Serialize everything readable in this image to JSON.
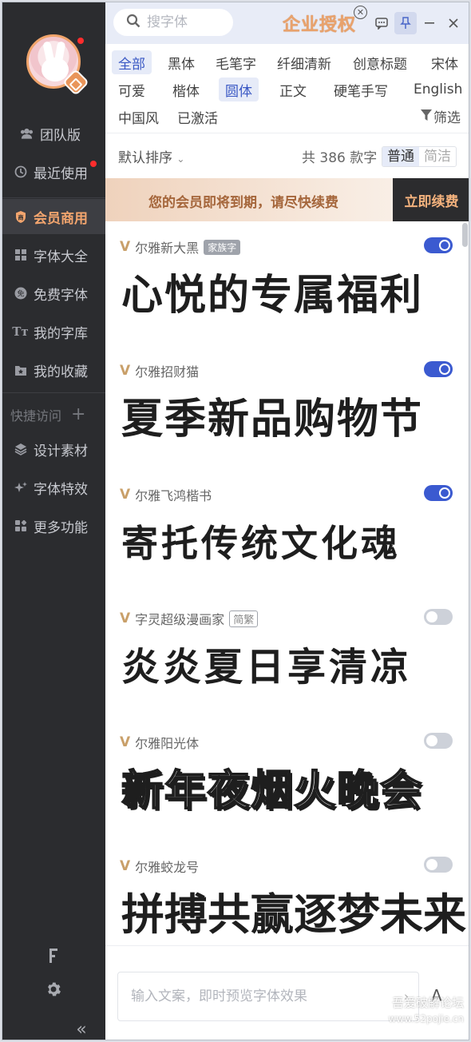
{
  "sidebar": {
    "items": [
      {
        "label": "团队版",
        "icon": "team-icon"
      },
      {
        "label": "最近使用",
        "icon": "clock-icon"
      },
      {
        "label": "会员商用",
        "icon": "shield-icon"
      },
      {
        "label": "字体大全",
        "icon": "grid-icon"
      },
      {
        "label": "免费字体",
        "icon": "free-icon"
      },
      {
        "label": "我的字库",
        "icon": "tt-icon"
      },
      {
        "label": "我的收藏",
        "icon": "star-folder-icon"
      }
    ],
    "quick_access_label": "快捷访问",
    "quick_items": [
      {
        "label": "设计素材",
        "icon": "layers-icon"
      },
      {
        "label": "字体特效",
        "icon": "sparkle-icon"
      },
      {
        "label": "更多功能",
        "icon": "apps-icon"
      }
    ],
    "collapse_label": "«"
  },
  "topbar": {
    "search_placeholder": "搜字体",
    "brand": "企业授权"
  },
  "categories": [
    "全部",
    "黑体",
    "毛笔字",
    "纤细清新",
    "创意标题",
    "宋体",
    "可爱",
    "楷体",
    "圆体",
    "正文",
    "硬笔手写",
    "English",
    "中国风",
    "已激活"
  ],
  "filter_label": "筛选",
  "sort": {
    "label": "默认排序",
    "count_text": "共 386 款字",
    "mode_normal": "普通",
    "mode_simple": "简洁"
  },
  "banner": {
    "text": "您的会员即将到期，请尽快续费",
    "button": "立即续费"
  },
  "fonts": [
    {
      "name": "尔雅新大黑",
      "tag": "家族字",
      "preview": "心悦的专属福利",
      "enabled": true
    },
    {
      "name": "尔雅招财猫",
      "tag": "",
      "preview": "夏季新品购物节",
      "enabled": true
    },
    {
      "name": "尔雅飞鸿楷书",
      "tag": "",
      "preview": "寄托传统文化魂",
      "enabled": true
    },
    {
      "name": "字灵超级漫画家",
      "tag": "简繁",
      "preview": "炎炎夏日享清凉",
      "enabled": false
    },
    {
      "name": "尔雅阳光体",
      "tag": "",
      "preview": "新年夜烟火晚会",
      "enabled": false
    },
    {
      "name": "尔雅蛟龙号",
      "tag": "",
      "preview": "拼搏共赢逐梦未来",
      "enabled": false
    }
  ],
  "bottom": {
    "input_placeholder": "输入文案，即时预览字体效果",
    "font_btn": "A",
    "watermark": "吾爱破解论坛",
    "watermark_url": "www.52pojie.cn"
  }
}
